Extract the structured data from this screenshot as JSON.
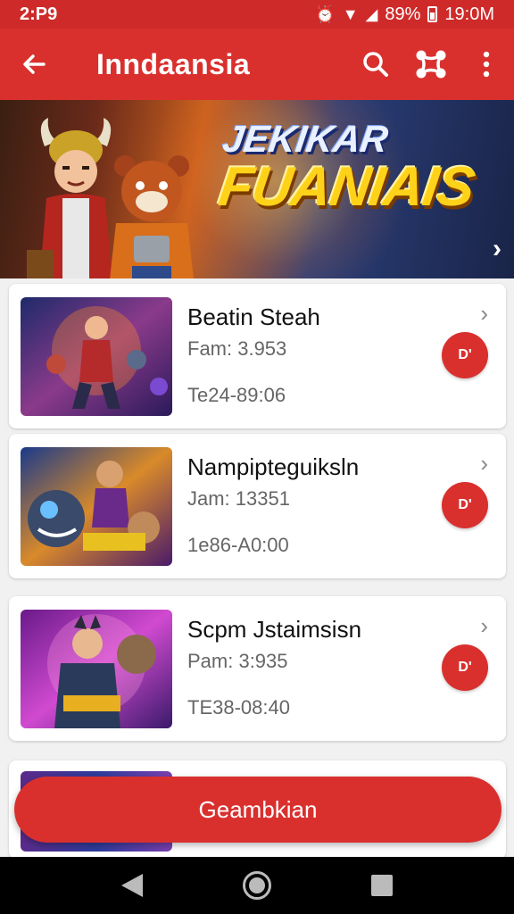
{
  "status": {
    "time": "2:P9",
    "battery": "89%",
    "clock": "19:0M"
  },
  "appbar": {
    "title": "Inndaansia"
  },
  "banner": {
    "title_line1": "JEKIKAR",
    "title_line2": "FUANIAIS"
  },
  "items": [
    {
      "title": "Beatin Steah",
      "subtitle": "Fam: 3.953",
      "date": "Te24-89:06",
      "button_label": "D'"
    },
    {
      "title": "Nampipteguiksln",
      "subtitle": "Jam: 13351",
      "date": "1e86-A0:00",
      "button_label": "D'"
    },
    {
      "title": "Scpm Jstaimsisn",
      "subtitle": "Pam: 3:935",
      "date": "TE38-08:40",
      "button_label": "D'"
    }
  ],
  "cta": {
    "label": "Geambkian"
  },
  "colors": {
    "primary": "#d9302e",
    "status_bar": "#cf2a2a",
    "background": "#f1f1f1"
  },
  "icons": [
    "back-arrow-icon",
    "search-icon",
    "share-icon",
    "more-vert-icon",
    "chevron-right-icon",
    "play-icon"
  ]
}
